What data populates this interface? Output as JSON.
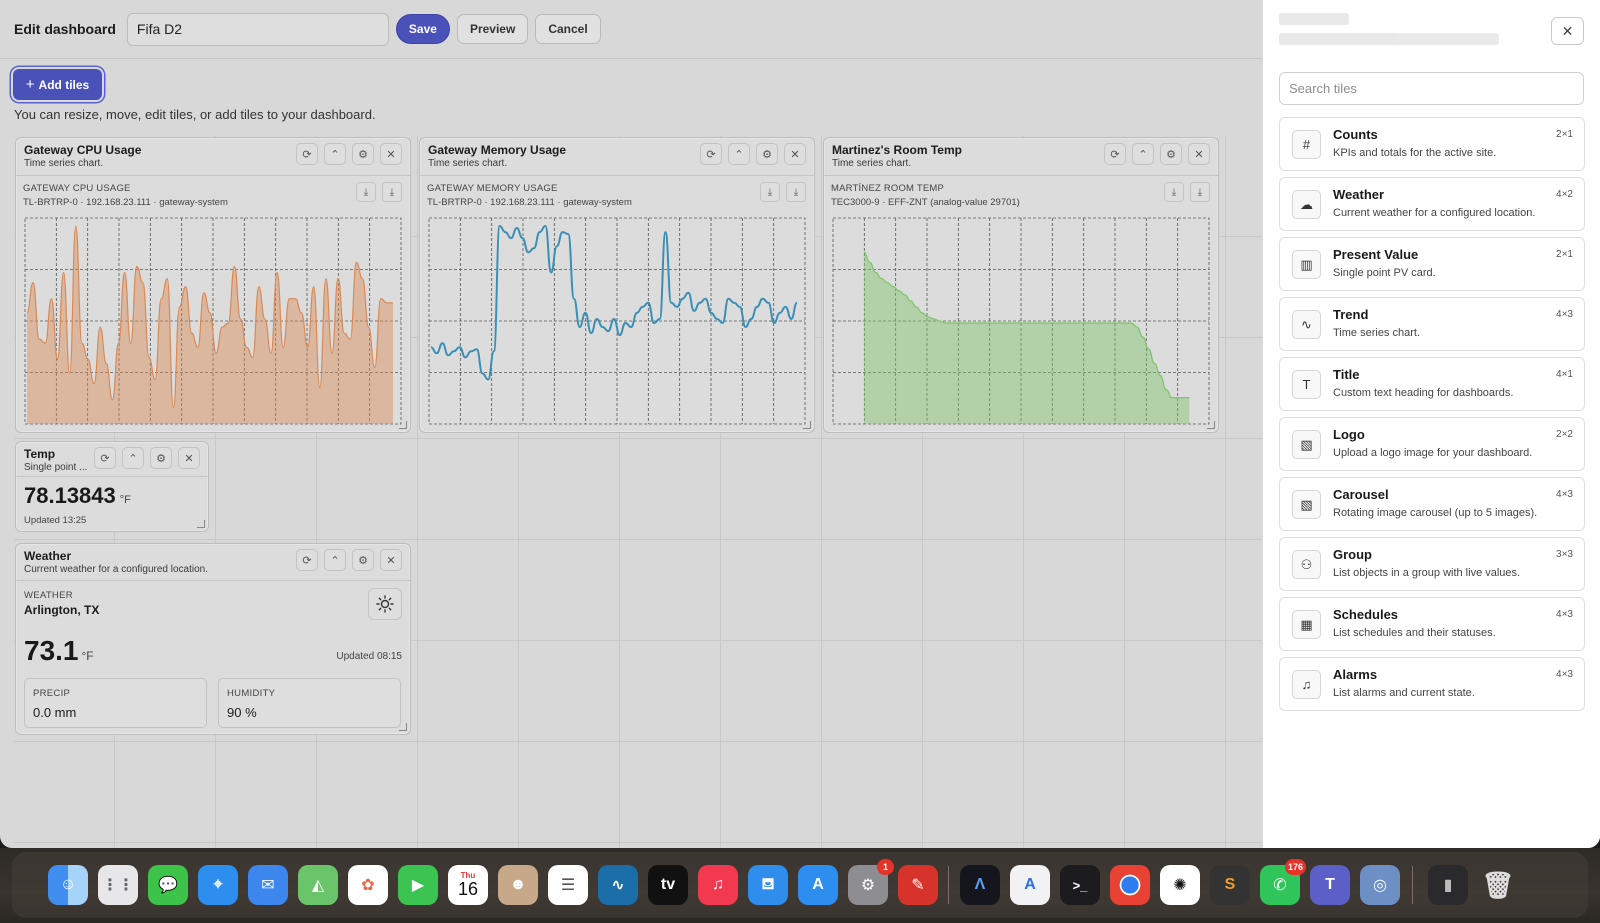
{
  "header": {
    "title": "Edit dashboard",
    "dashboard_name": "Fifa D2",
    "save": "Save",
    "preview": "Preview",
    "cancel": "Cancel"
  },
  "add_tiles": "Add tiles",
  "hint": "You can resize, move, edit tiles, or add tiles to your dashboard.",
  "tiles": {
    "cpu": {
      "title": "Gateway CPU Usage",
      "subtitle": "Time series chart.",
      "caption": "GATEWAY CPU USAGE",
      "source": "TL-BRTRP-0 · 192.168.23.111 · gateway-system",
      "color": "#d98a57"
    },
    "mem": {
      "title": "Gateway Memory Usage",
      "subtitle": "Time series chart.",
      "caption": "GATEWAY MEMORY USAGE",
      "source": "TL-BRTRP-0 · 192.168.23.111 · gateway-system",
      "color": "#3b8fb5"
    },
    "room": {
      "title": "Martinez's Room Temp",
      "subtitle": "Time series chart.",
      "caption": "MARTÍNEZ ROOM TEMP",
      "source": "TEC3000-9 · EFF-ZNT (analog-value 29701)",
      "color": "#7ec36a"
    },
    "temp": {
      "title": "Temp",
      "subtitle": "Single point ...",
      "value": "78.13843",
      "unit": "°F",
      "updated": "Updated 13:25"
    },
    "weather": {
      "title": "Weather",
      "subtitle": "Current weather for a configured location.",
      "caption": "WEATHER",
      "location": "Arlington, TX",
      "temp": "73.1",
      "unit": "°F",
      "updated": "Updated 08:15",
      "precip_label": "PRECIP",
      "precip": "0.0 mm",
      "humidity_label": "HUMIDITY",
      "humidity": "90 %"
    }
  },
  "chart_data": [
    {
      "type": "area",
      "title": "GATEWAY CPU USAGE",
      "series": [
        {
          "values": [
            55,
            70,
            42,
            40,
            62,
            32,
            75,
            25,
            98,
            40,
            32,
            20,
            48,
            30,
            12,
            40,
            75,
            40,
            78,
            70,
            33,
            22,
            62,
            72,
            8,
            58,
            68,
            45,
            38,
            65,
            55,
            35,
            48,
            50,
            78,
            52,
            38,
            33,
            68,
            52,
            35,
            75,
            38,
            62,
            62,
            55,
            38,
            68,
            18,
            72,
            35,
            72,
            45,
            42,
            80,
            72,
            48,
            28,
            62,
            60,
            60
          ]
        }
      ],
      "ylim": [
        0,
        100
      ]
    },
    {
      "type": "line",
      "title": "GATEWAY MEMORY USAGE",
      "series": [
        {
          "values": [
            38,
            35,
            40,
            34,
            36,
            38,
            33,
            36,
            37,
            25,
            22,
            36,
            98,
            95,
            92,
            97,
            92,
            85,
            87,
            95,
            98,
            75,
            88,
            95,
            94,
            62,
            48,
            55,
            45,
            52,
            48,
            46,
            52,
            44,
            50,
            48,
            55,
            58,
            60,
            50,
            52,
            95,
            60,
            58,
            62,
            65,
            56,
            60,
            62,
            55,
            52,
            50,
            62,
            60,
            58,
            48,
            52,
            58,
            62,
            60,
            50,
            55,
            58,
            52,
            60
          ]
        }
      ],
      "ylim": [
        0,
        100
      ]
    },
    {
      "type": "area",
      "title": "MARTÍNEZ ROOM TEMP",
      "series": [
        {
          "values": [
            null,
            null,
            null,
            null,
            null,
            85,
            80,
            75,
            72,
            70,
            68,
            66,
            64,
            61,
            58,
            55,
            53,
            52,
            51,
            50,
            50,
            50,
            50,
            50,
            50,
            50,
            50,
            50,
            50,
            50,
            50,
            50,
            50,
            50,
            50,
            50,
            50,
            50,
            50,
            50,
            50,
            50,
            50,
            50,
            50,
            50,
            50,
            50,
            50,
            50,
            50,
            50,
            48,
            43,
            37,
            30,
            24,
            17,
            13,
            13,
            13,
            13,
            null,
            null
          ]
        }
      ],
      "ylim": [
        0,
        100
      ]
    }
  ],
  "panel": {
    "search_placeholder": "Search tiles",
    "items": [
      {
        "name": "Counts",
        "desc": "KPIs and totals for the active site.",
        "size": "2×1",
        "icon": "hash-icon",
        "glyph": "#"
      },
      {
        "name": "Weather",
        "desc": "Current weather for a configured location.",
        "size": "4×2",
        "icon": "cloud-icon",
        "glyph": "☁"
      },
      {
        "name": "Present Value",
        "desc": "Single point PV card.",
        "size": "2×1",
        "icon": "bar-chart-icon",
        "glyph": "▥"
      },
      {
        "name": "Trend",
        "desc": "Time series chart.",
        "size": "4×3",
        "icon": "trend-line-icon",
        "glyph": "∿"
      },
      {
        "name": "Title",
        "desc": "Custom text heading for dashboards.",
        "size": "4×1",
        "icon": "text-icon",
        "glyph": "T"
      },
      {
        "name": "Logo",
        "desc": "Upload a logo image for your dashboard.",
        "size": "2×2",
        "icon": "image-icon",
        "glyph": "▧"
      },
      {
        "name": "Carousel",
        "desc": "Rotating image carousel (up to 5 images).",
        "size": "4×3",
        "icon": "images-icon",
        "glyph": "▧"
      },
      {
        "name": "Group",
        "desc": "List objects in a group with live values.",
        "size": "3×3",
        "icon": "users-icon",
        "glyph": "⚇"
      },
      {
        "name": "Schedules",
        "desc": "List schedules and their statuses.",
        "size": "4×3",
        "icon": "calendar-icon",
        "glyph": "▦"
      },
      {
        "name": "Alarms",
        "desc": "List alarms and current state.",
        "size": "4×3",
        "icon": "bell-icon",
        "glyph": "♫"
      }
    ]
  },
  "dock": {
    "calendar_day_label": "Thu",
    "calendar_day": "16",
    "tv_label": "tv",
    "settings_badge": "1",
    "whatsapp_badge": "176"
  }
}
